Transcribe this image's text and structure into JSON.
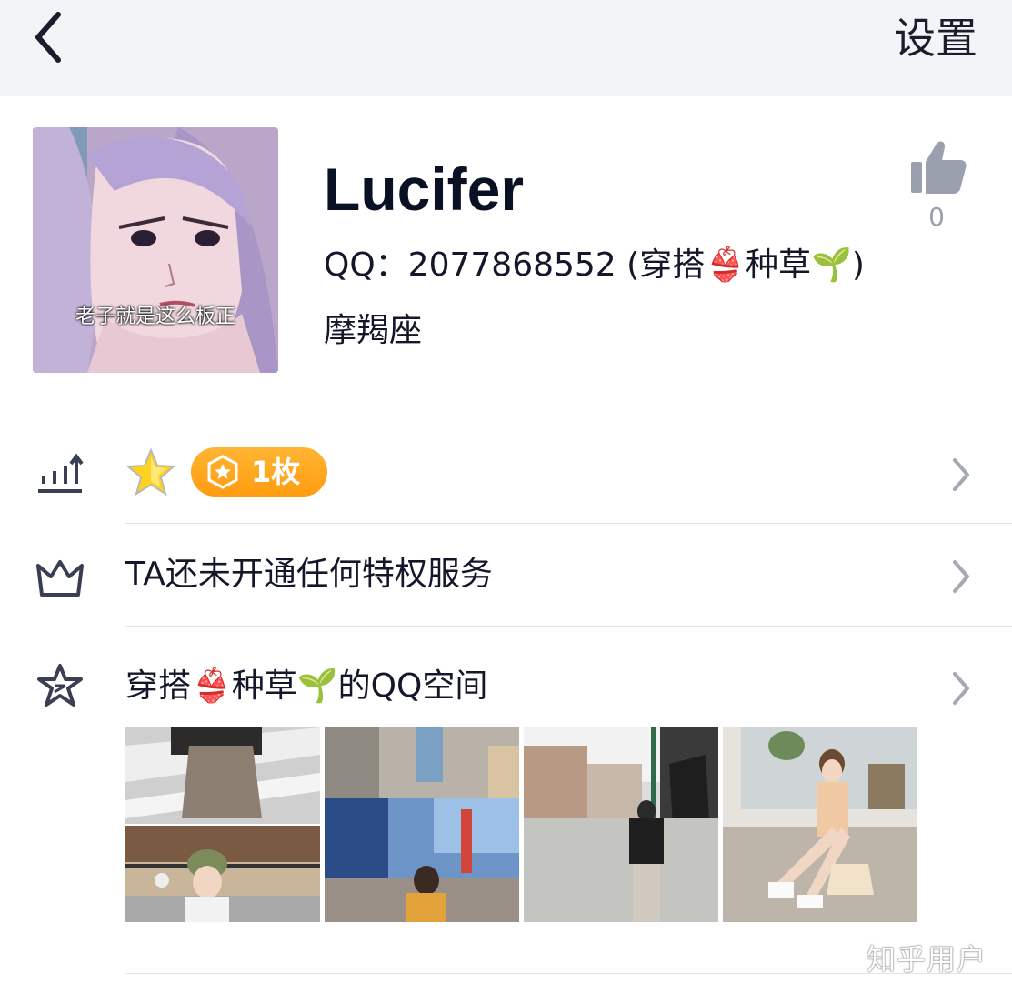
{
  "header": {
    "back_icon": "chevron-left-icon",
    "settings_label": "设置"
  },
  "profile": {
    "avatar_caption": "老子就是这么板正",
    "nickname": "Lucifer",
    "qq_line": "QQ：2077868552 (穿搭👙种草🌱)",
    "zodiac": "摩羯座",
    "like_icon": "thumbs-up-icon",
    "like_count": "0"
  },
  "rows": {
    "level": {
      "icon": "level-chart-icon",
      "badge_label": "1枚"
    },
    "privilege": {
      "icon": "crown-icon",
      "label": "TA还未开通任何特权服务"
    },
    "qzone": {
      "icon": "star-outline-icon",
      "label": "穿搭👙种草🌱的QQ空间"
    }
  },
  "photos_alt": [
    "photo-1",
    "photo-2",
    "photo-3",
    "photo-4"
  ],
  "watermark": "知乎用户",
  "colors": {
    "header_bg": "#f3f4f8",
    "badge_orange": "#ffa41f",
    "icon_gray": "#9aa0ae",
    "text_dark": "#14172a"
  }
}
